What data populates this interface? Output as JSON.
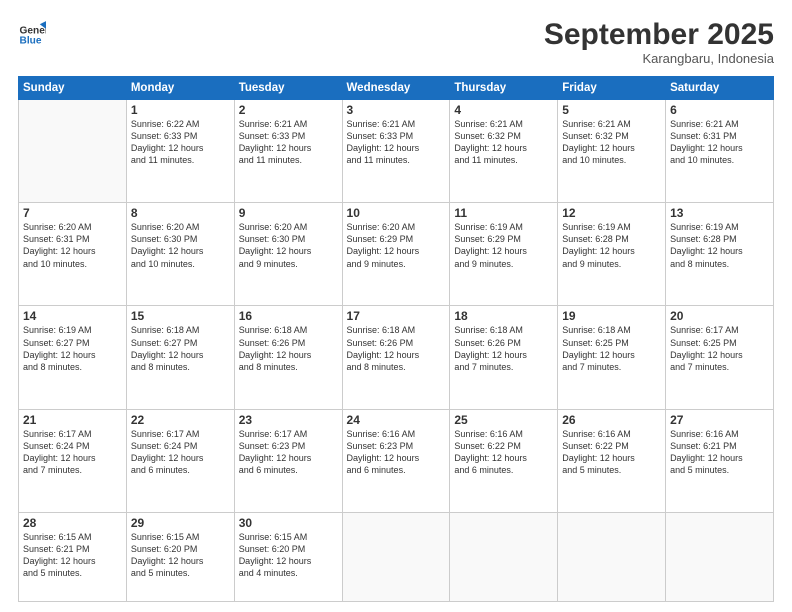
{
  "header": {
    "logo_line1": "General",
    "logo_line2": "Blue",
    "month": "September 2025",
    "location": "Karangbaru, Indonesia"
  },
  "weekdays": [
    "Sunday",
    "Monday",
    "Tuesday",
    "Wednesday",
    "Thursday",
    "Friday",
    "Saturday"
  ],
  "weeks": [
    [
      {
        "day": "",
        "info": ""
      },
      {
        "day": "1",
        "info": "Sunrise: 6:22 AM\nSunset: 6:33 PM\nDaylight: 12 hours\nand 11 minutes."
      },
      {
        "day": "2",
        "info": "Sunrise: 6:21 AM\nSunset: 6:33 PM\nDaylight: 12 hours\nand 11 minutes."
      },
      {
        "day": "3",
        "info": "Sunrise: 6:21 AM\nSunset: 6:33 PM\nDaylight: 12 hours\nand 11 minutes."
      },
      {
        "day": "4",
        "info": "Sunrise: 6:21 AM\nSunset: 6:32 PM\nDaylight: 12 hours\nand 11 minutes."
      },
      {
        "day": "5",
        "info": "Sunrise: 6:21 AM\nSunset: 6:32 PM\nDaylight: 12 hours\nand 10 minutes."
      },
      {
        "day": "6",
        "info": "Sunrise: 6:21 AM\nSunset: 6:31 PM\nDaylight: 12 hours\nand 10 minutes."
      }
    ],
    [
      {
        "day": "7",
        "info": "Sunrise: 6:20 AM\nSunset: 6:31 PM\nDaylight: 12 hours\nand 10 minutes."
      },
      {
        "day": "8",
        "info": "Sunrise: 6:20 AM\nSunset: 6:30 PM\nDaylight: 12 hours\nand 10 minutes."
      },
      {
        "day": "9",
        "info": "Sunrise: 6:20 AM\nSunset: 6:30 PM\nDaylight: 12 hours\nand 9 minutes."
      },
      {
        "day": "10",
        "info": "Sunrise: 6:20 AM\nSunset: 6:29 PM\nDaylight: 12 hours\nand 9 minutes."
      },
      {
        "day": "11",
        "info": "Sunrise: 6:19 AM\nSunset: 6:29 PM\nDaylight: 12 hours\nand 9 minutes."
      },
      {
        "day": "12",
        "info": "Sunrise: 6:19 AM\nSunset: 6:28 PM\nDaylight: 12 hours\nand 9 minutes."
      },
      {
        "day": "13",
        "info": "Sunrise: 6:19 AM\nSunset: 6:28 PM\nDaylight: 12 hours\nand 8 minutes."
      }
    ],
    [
      {
        "day": "14",
        "info": "Sunrise: 6:19 AM\nSunset: 6:27 PM\nDaylight: 12 hours\nand 8 minutes."
      },
      {
        "day": "15",
        "info": "Sunrise: 6:18 AM\nSunset: 6:27 PM\nDaylight: 12 hours\nand 8 minutes."
      },
      {
        "day": "16",
        "info": "Sunrise: 6:18 AM\nSunset: 6:26 PM\nDaylight: 12 hours\nand 8 minutes."
      },
      {
        "day": "17",
        "info": "Sunrise: 6:18 AM\nSunset: 6:26 PM\nDaylight: 12 hours\nand 8 minutes."
      },
      {
        "day": "18",
        "info": "Sunrise: 6:18 AM\nSunset: 6:26 PM\nDaylight: 12 hours\nand 7 minutes."
      },
      {
        "day": "19",
        "info": "Sunrise: 6:18 AM\nSunset: 6:25 PM\nDaylight: 12 hours\nand 7 minutes."
      },
      {
        "day": "20",
        "info": "Sunrise: 6:17 AM\nSunset: 6:25 PM\nDaylight: 12 hours\nand 7 minutes."
      }
    ],
    [
      {
        "day": "21",
        "info": "Sunrise: 6:17 AM\nSunset: 6:24 PM\nDaylight: 12 hours\nand 7 minutes."
      },
      {
        "day": "22",
        "info": "Sunrise: 6:17 AM\nSunset: 6:24 PM\nDaylight: 12 hours\nand 6 minutes."
      },
      {
        "day": "23",
        "info": "Sunrise: 6:17 AM\nSunset: 6:23 PM\nDaylight: 12 hours\nand 6 minutes."
      },
      {
        "day": "24",
        "info": "Sunrise: 6:16 AM\nSunset: 6:23 PM\nDaylight: 12 hours\nand 6 minutes."
      },
      {
        "day": "25",
        "info": "Sunrise: 6:16 AM\nSunset: 6:22 PM\nDaylight: 12 hours\nand 6 minutes."
      },
      {
        "day": "26",
        "info": "Sunrise: 6:16 AM\nSunset: 6:22 PM\nDaylight: 12 hours\nand 5 minutes."
      },
      {
        "day": "27",
        "info": "Sunrise: 6:16 AM\nSunset: 6:21 PM\nDaylight: 12 hours\nand 5 minutes."
      }
    ],
    [
      {
        "day": "28",
        "info": "Sunrise: 6:15 AM\nSunset: 6:21 PM\nDaylight: 12 hours\nand 5 minutes."
      },
      {
        "day": "29",
        "info": "Sunrise: 6:15 AM\nSunset: 6:20 PM\nDaylight: 12 hours\nand 5 minutes."
      },
      {
        "day": "30",
        "info": "Sunrise: 6:15 AM\nSunset: 6:20 PM\nDaylight: 12 hours\nand 4 minutes."
      },
      {
        "day": "",
        "info": ""
      },
      {
        "day": "",
        "info": ""
      },
      {
        "day": "",
        "info": ""
      },
      {
        "day": "",
        "info": ""
      }
    ]
  ]
}
